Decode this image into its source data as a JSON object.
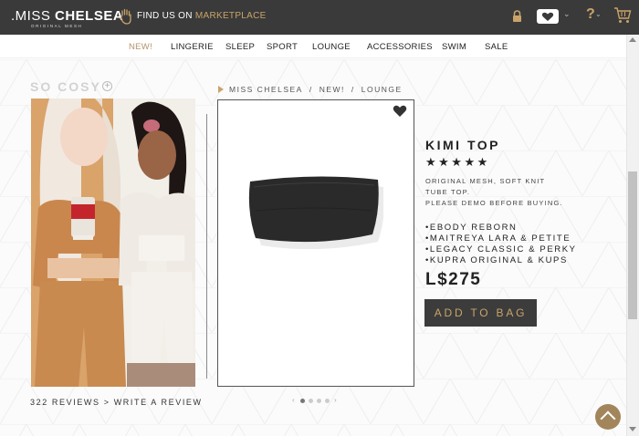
{
  "header": {
    "logo_main_prefix": ".MISS ",
    "logo_main_bold": "CHELSEA",
    "logo_sub": "ORIGINAL MESH",
    "findus_prefix": "FIND US ON ",
    "findus_link": "MARKETPLACE",
    "icons": [
      "hand-icon",
      "lock-icon",
      "wishlist-heart-icon",
      "help-icon",
      "cart-icon"
    ]
  },
  "nav": {
    "items": [
      "NEW!",
      "LINGERIE",
      "SLEEP",
      "SPORT",
      "LOUNGE",
      "ACCESSORIES",
      "SWIM",
      "SALE"
    ],
    "active": "NEW!"
  },
  "lookbook": {
    "title": "SO COSY",
    "reviews_link": "322 REVIEWS",
    "reviews_sep": ">",
    "write_review": "WRITE A REVIEW"
  },
  "breadcrumb": [
    "MISS CHELSEA",
    "NEW!",
    "LOUNGE"
  ],
  "product": {
    "name": "KIMI TOP",
    "rating_stars": "★★★★★",
    "rating": 5,
    "description": [
      "ORIGINAL MESH, SOFT KNIT",
      "TUBE TOP.",
      "PLEASE DEMO BEFORE BUYING."
    ],
    "bodies": [
      "•EBODY REBORN",
      "•MAITREYA LARA & PETITE",
      "•LEGACY CLASSIC & PERKY",
      "•KUPRA ORIGINAL & KUPS"
    ],
    "price": "L$275",
    "add_to_bag": "ADD TO BAG"
  },
  "carousel": {
    "prev": "‹",
    "next": "›",
    "count": 5,
    "active_index": 0
  },
  "colors": {
    "topbar": "#3a3a3a",
    "accent_gold": "#c9a46a",
    "button": "#3c3c3c"
  }
}
